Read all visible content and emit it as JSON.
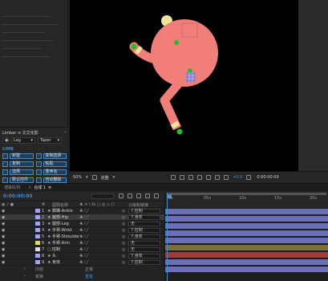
{
  "limber": {
    "title": "Limber ≡ 文文化影",
    "side_select": "Leg",
    "taper_select": "Taper",
    "section": "LIMB",
    "buttons": [
      {
        "label": "新建",
        "icon": "limb-new-icon"
      },
      {
        "label": "复制选择",
        "icon": "copy-selection-icon"
      },
      {
        "label": "复制",
        "icon": "copy-icon"
      },
      {
        "label": "粘贴",
        "icon": "paste-icon"
      },
      {
        "label": "选择",
        "icon": "select-icon"
      },
      {
        "label": "重命名",
        "icon": "rename-icon"
      },
      {
        "label": "默认控件",
        "icon": "default-controls-icon"
      },
      {
        "label": "自动删除",
        "icon": "auto-delete-icon"
      }
    ]
  },
  "viewer": {
    "zoom": "50%",
    "quality": "完整",
    "exposure": "+0.0",
    "timecode": "0:00:00:00",
    "colors": {
      "limb": "#f27e7a",
      "joint": "#1fbf2a",
      "head": "#f2e29a",
      "bg": "#000000"
    }
  },
  "timeline": {
    "tabs": [
      {
        "label": "渲染队列",
        "active": false
      },
      {
        "label": "合成 1",
        "active": true
      }
    ],
    "timecode": "0:00:00:00",
    "columns": {
      "source_name": "图层名称",
      "parent": "父级和链接"
    },
    "ruler_ticks": [
      "0s",
      "05s",
      "10s",
      "15s",
      "20s"
    ],
    "layers": [
      {
        "num": "1",
        "name": "脚踝-Ankle",
        "parent": "7.控制",
        "color": "#a0a0ff",
        "bar": "#6b6fb8",
        "selected": false
      },
      {
        "num": "2",
        "name": "腿部-Hip",
        "parent": "7.身体",
        "color": "#a0a0ff",
        "bar": "#6b6fb8",
        "selected": true
      },
      {
        "num": "3",
        "name": "腿部-Leg",
        "parent": "无",
        "color": "#a0a0ff",
        "bar": "#6b6fb8",
        "selected": false
      },
      {
        "num": "4",
        "name": "手臂-Wrist",
        "parent": "7.控制",
        "color": "#a0a0ff",
        "bar": "#6b6fb8",
        "selected": false
      },
      {
        "num": "5",
        "name": "手臂-Shoulder",
        "parent": "7.身体",
        "color": "#a0a0ff",
        "bar": "#6b6fb8",
        "selected": false
      },
      {
        "num": "6",
        "name": "手臂-Arm",
        "parent": "无",
        "color": "#e8d65a",
        "bar": "#7b6f36",
        "selected": false
      },
      {
        "num": "7",
        "name": "控制",
        "parent": "无",
        "color": "#dddddd",
        "bar": "#a33a3a",
        "selected": false
      },
      {
        "num": "8",
        "name": "头",
        "parent": "7.身体",
        "color": "#a0a0ff",
        "bar": "#6b6fb8",
        "selected": false
      },
      {
        "num": "9",
        "name": "身体",
        "parent": "7.控制",
        "color": "#a0a0ff",
        "bar": "#6b6fb8",
        "selected": false
      }
    ],
    "sub_rows": [
      {
        "label": "内容",
        "value": ""
      },
      {
        "label": "变换",
        "value": "重置"
      }
    ],
    "blend_mode": "正常"
  }
}
